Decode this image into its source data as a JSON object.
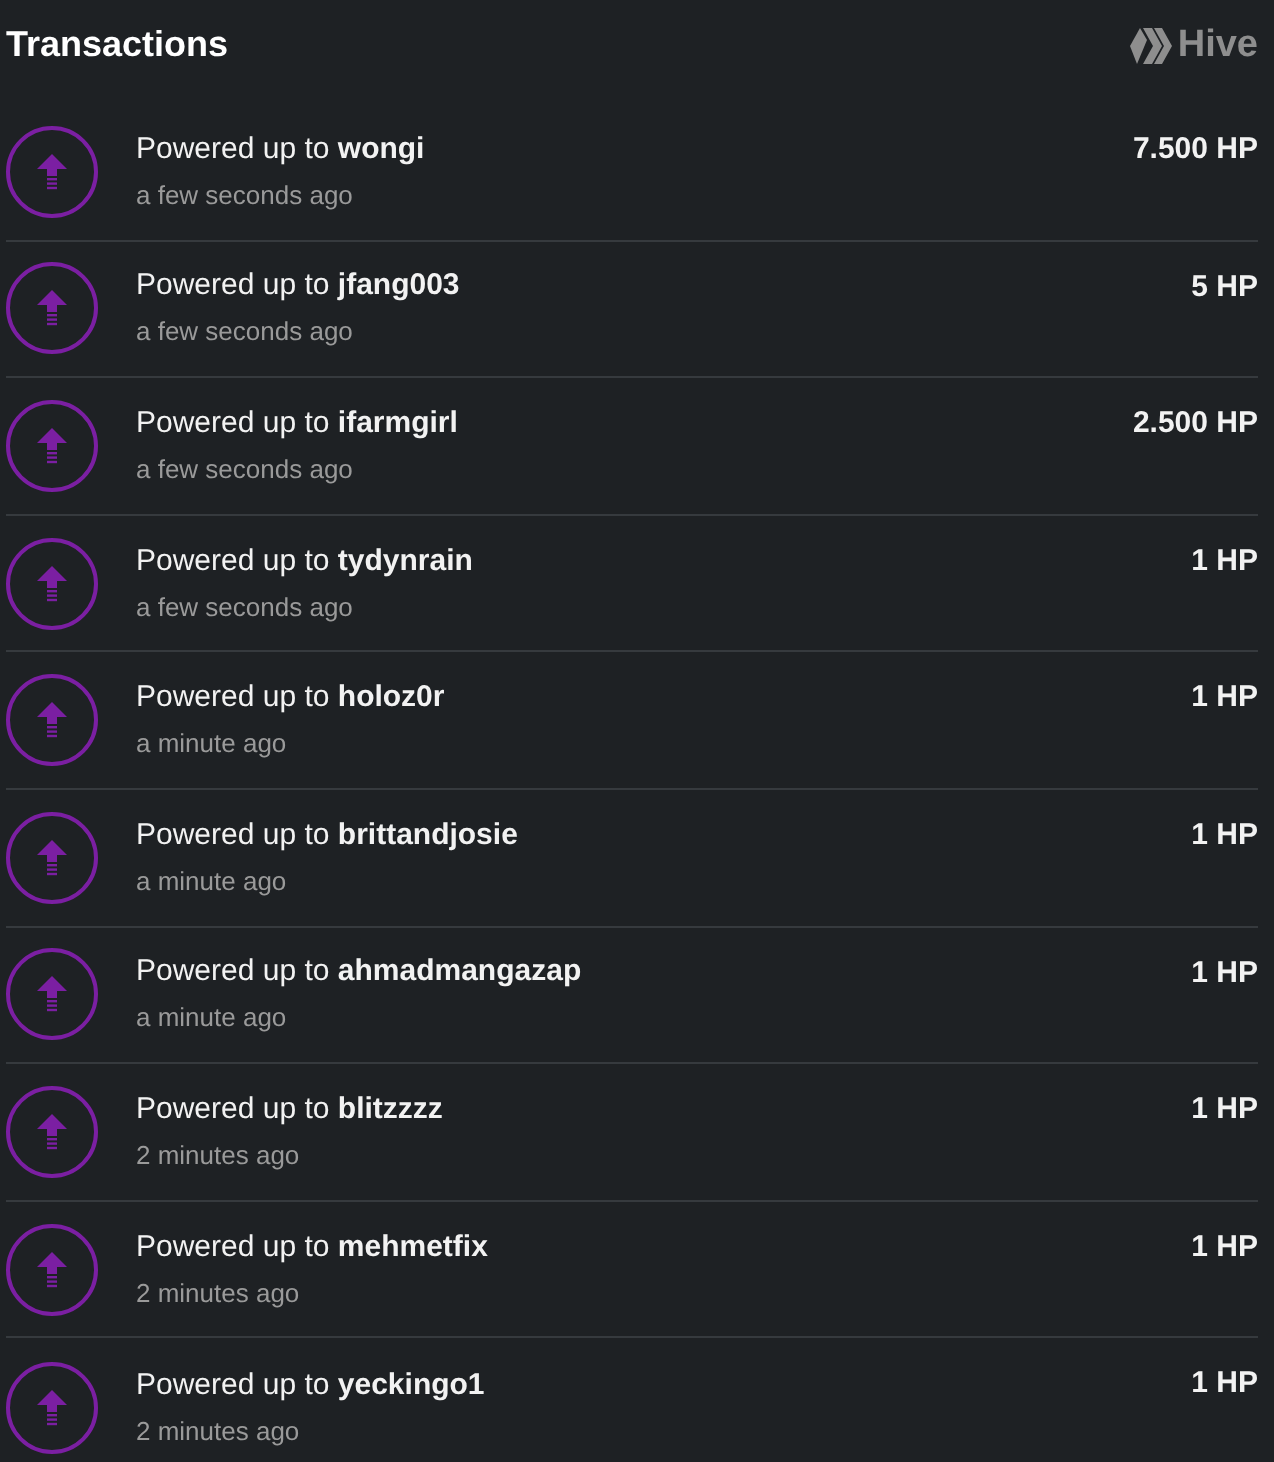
{
  "title": "Transactions",
  "brand": {
    "name": "Hive"
  },
  "transactions": [
    {
      "description": "Powered up to **wongi**",
      "time": "a few seconds ago",
      "amount": "7.500 HP"
    },
    {
      "description": "Powered up to **jfang003**",
      "time": "a few seconds ago",
      "amount": "5 HP"
    },
    {
      "description": "Powered up to **ifarmgirl**",
      "time": "a few seconds ago",
      "amount": "2.500 HP"
    },
    {
      "description": "Powered up to **tydynrain**",
      "time": "a few seconds ago",
      "amount": "1 HP"
    },
    {
      "description": "Powered up to **holoz0r**",
      "time": "a minute ago",
      "amount": "1 HP"
    },
    {
      "description": "Powered up to **brittandjosie**",
      "time": "a minute ago",
      "amount": "1 HP"
    },
    {
      "description": "Powered up to **ahmadmangazap**",
      "time": "a minute ago",
      "amount": "1 HP"
    },
    {
      "description": "Powered up to **blitzzzz**",
      "time": "2 minutes ago",
      "amount": "1 HP"
    },
    {
      "description": "Powered up to **mehmetfix**",
      "time": "2 minutes ago",
      "amount": "1 HP"
    },
    {
      "description": "Powered up to **yeckingo1**",
      "time": "2 minutes ago",
      "amount": "1 HP"
    }
  ]
}
